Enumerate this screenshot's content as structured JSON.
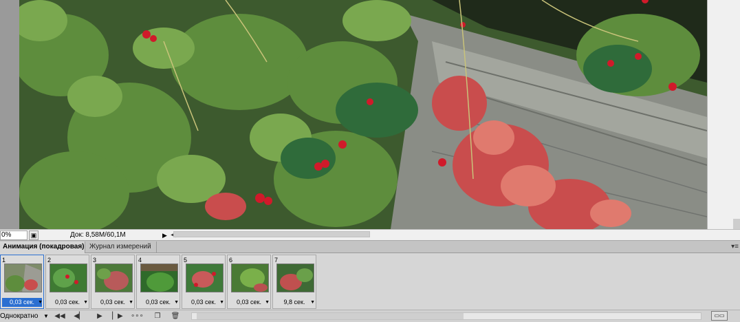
{
  "status": {
    "zoom_value": "0%",
    "zoom_button_icon": "document-icon",
    "doc_info": "Док: 8,58M/60,1M",
    "doc_info_arrow": "▶",
    "scroll_left_arrow": "◀"
  },
  "panel": {
    "tabs": [
      {
        "label": "Анимация (покадровая)",
        "active": true
      },
      {
        "label": "Журнал измерений",
        "active": false
      }
    ],
    "menu_icon": "panel-menu-icon",
    "menu_glyph": "▾≡",
    "frames": [
      {
        "number": "1",
        "delay": "0,03 сек.",
        "selected": true
      },
      {
        "number": "2",
        "delay": "0,03 сек.",
        "selected": false
      },
      {
        "number": "3",
        "delay": "0,03 сек.",
        "selected": false
      },
      {
        "number": "4",
        "delay": "0,03 сек.",
        "selected": false
      },
      {
        "number": "5",
        "delay": "0,03 сек.",
        "selected": false
      },
      {
        "number": "6",
        "delay": "0,03 сек.",
        "selected": false
      },
      {
        "number": "7",
        "delay": "9,8 сек.",
        "selected": false
      }
    ],
    "loop_option": "Однократно",
    "controls": [
      {
        "name": "first-frame-icon",
        "glyph": "◀◀"
      },
      {
        "name": "previous-frame-icon",
        "glyph": "◀▏"
      },
      {
        "name": "play-icon",
        "glyph": "▶"
      },
      {
        "name": "next-frame-icon",
        "glyph": "▏▶"
      },
      {
        "name": "tween-icon",
        "glyph": "∘∘∘"
      },
      {
        "name": "duplicate-frame-icon",
        "glyph": "❐"
      },
      {
        "name": "delete-frame-icon",
        "glyph": "🗑"
      }
    ]
  },
  "colors": {
    "selection_blue": "#2b6fd1",
    "panel_gray": "#d6d6d6"
  }
}
